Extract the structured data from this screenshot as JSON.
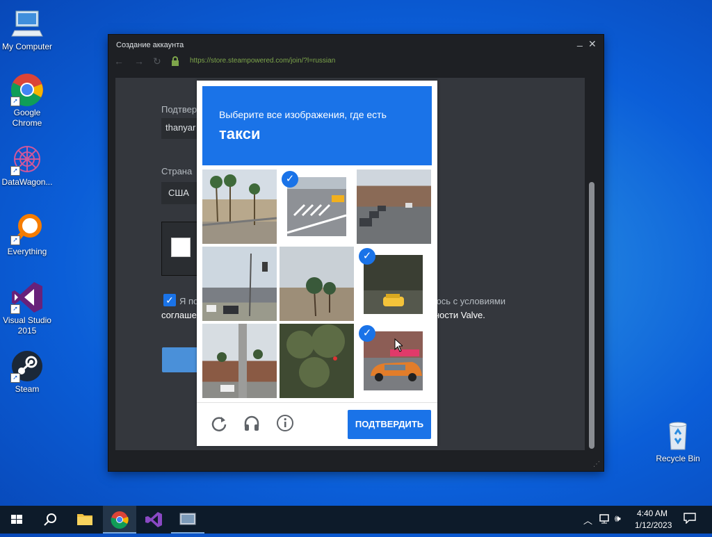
{
  "desktop": {
    "icons": [
      {
        "label": "My Computer"
      },
      {
        "label": "Google Chrome"
      },
      {
        "label": "DataWagon..."
      },
      {
        "label": "Everything"
      },
      {
        "label": "Visual Studio 2015"
      },
      {
        "label": "Steam"
      },
      {
        "label": "Recycle Bin"
      }
    ]
  },
  "window": {
    "title": "Создание аккаунта",
    "minimize": "_",
    "close": "✕",
    "url": "https://store.steampowered.com/join/?l=russian",
    "form": {
      "confirm_label": "Подтвер",
      "confirm_value": "thanyar",
      "country_label": "Страна",
      "country_value": "США",
      "agree_text_1": "Я по",
      "agree_text_1_right": "юсь с условиями",
      "agree_text_2": "соглаше",
      "agree_text_2_right": "ности Valve."
    }
  },
  "captcha": {
    "prompt": "Выберите все изображения, где есть",
    "target": "такси",
    "verify_label": "ПОДТВЕРДИТЬ",
    "tiles_selected": [
      false,
      true,
      false,
      false,
      false,
      true,
      false,
      false,
      true
    ]
  },
  "taskbar": {
    "time": "4:40 AM",
    "date": "1/12/2023"
  }
}
